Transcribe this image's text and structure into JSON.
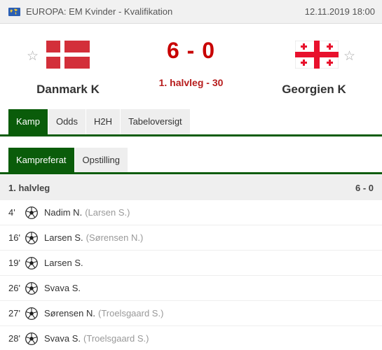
{
  "league": {
    "label": "EUROPA: EM Kvinder - Kvalifikation",
    "icon": "globe-icon"
  },
  "match_date": "12.11.2019 18:00",
  "home_team": {
    "name": "Danmark K",
    "flag": "denmark-flag"
  },
  "away_team": {
    "name": "Georgien K",
    "flag": "georgia-flag"
  },
  "score": "6 - 0",
  "status": "1. halvleg - 30",
  "tabs": [
    {
      "label": "Kamp",
      "active": true
    },
    {
      "label": "Odds",
      "active": false
    },
    {
      "label": "H2H",
      "active": false
    },
    {
      "label": "Tabeloversigt",
      "active": false
    }
  ],
  "subtabs": [
    {
      "label": "Kampreferat",
      "active": true
    },
    {
      "label": "Opstilling",
      "active": false
    }
  ],
  "period": {
    "title": "1. halvleg",
    "score": "6 - 0"
  },
  "events": [
    {
      "minute": "4'",
      "player": "Nadim N.",
      "assist": "(Larsen S.)"
    },
    {
      "minute": "16'",
      "player": "Larsen S.",
      "assist": "(Sørensen N.)"
    },
    {
      "minute": "19'",
      "player": "Larsen S.",
      "assist": ""
    },
    {
      "minute": "26'",
      "player": "Svava S.",
      "assist": ""
    },
    {
      "minute": "27'",
      "player": "Sørensen N.",
      "assist": "(Troelsgaard S.)"
    },
    {
      "minute": "28'",
      "player": "Svava S.",
      "assist": "(Troelsgaard S.)"
    }
  ],
  "colors": {
    "accent_green": "#0a5c0a",
    "score_red": "#c80000"
  }
}
